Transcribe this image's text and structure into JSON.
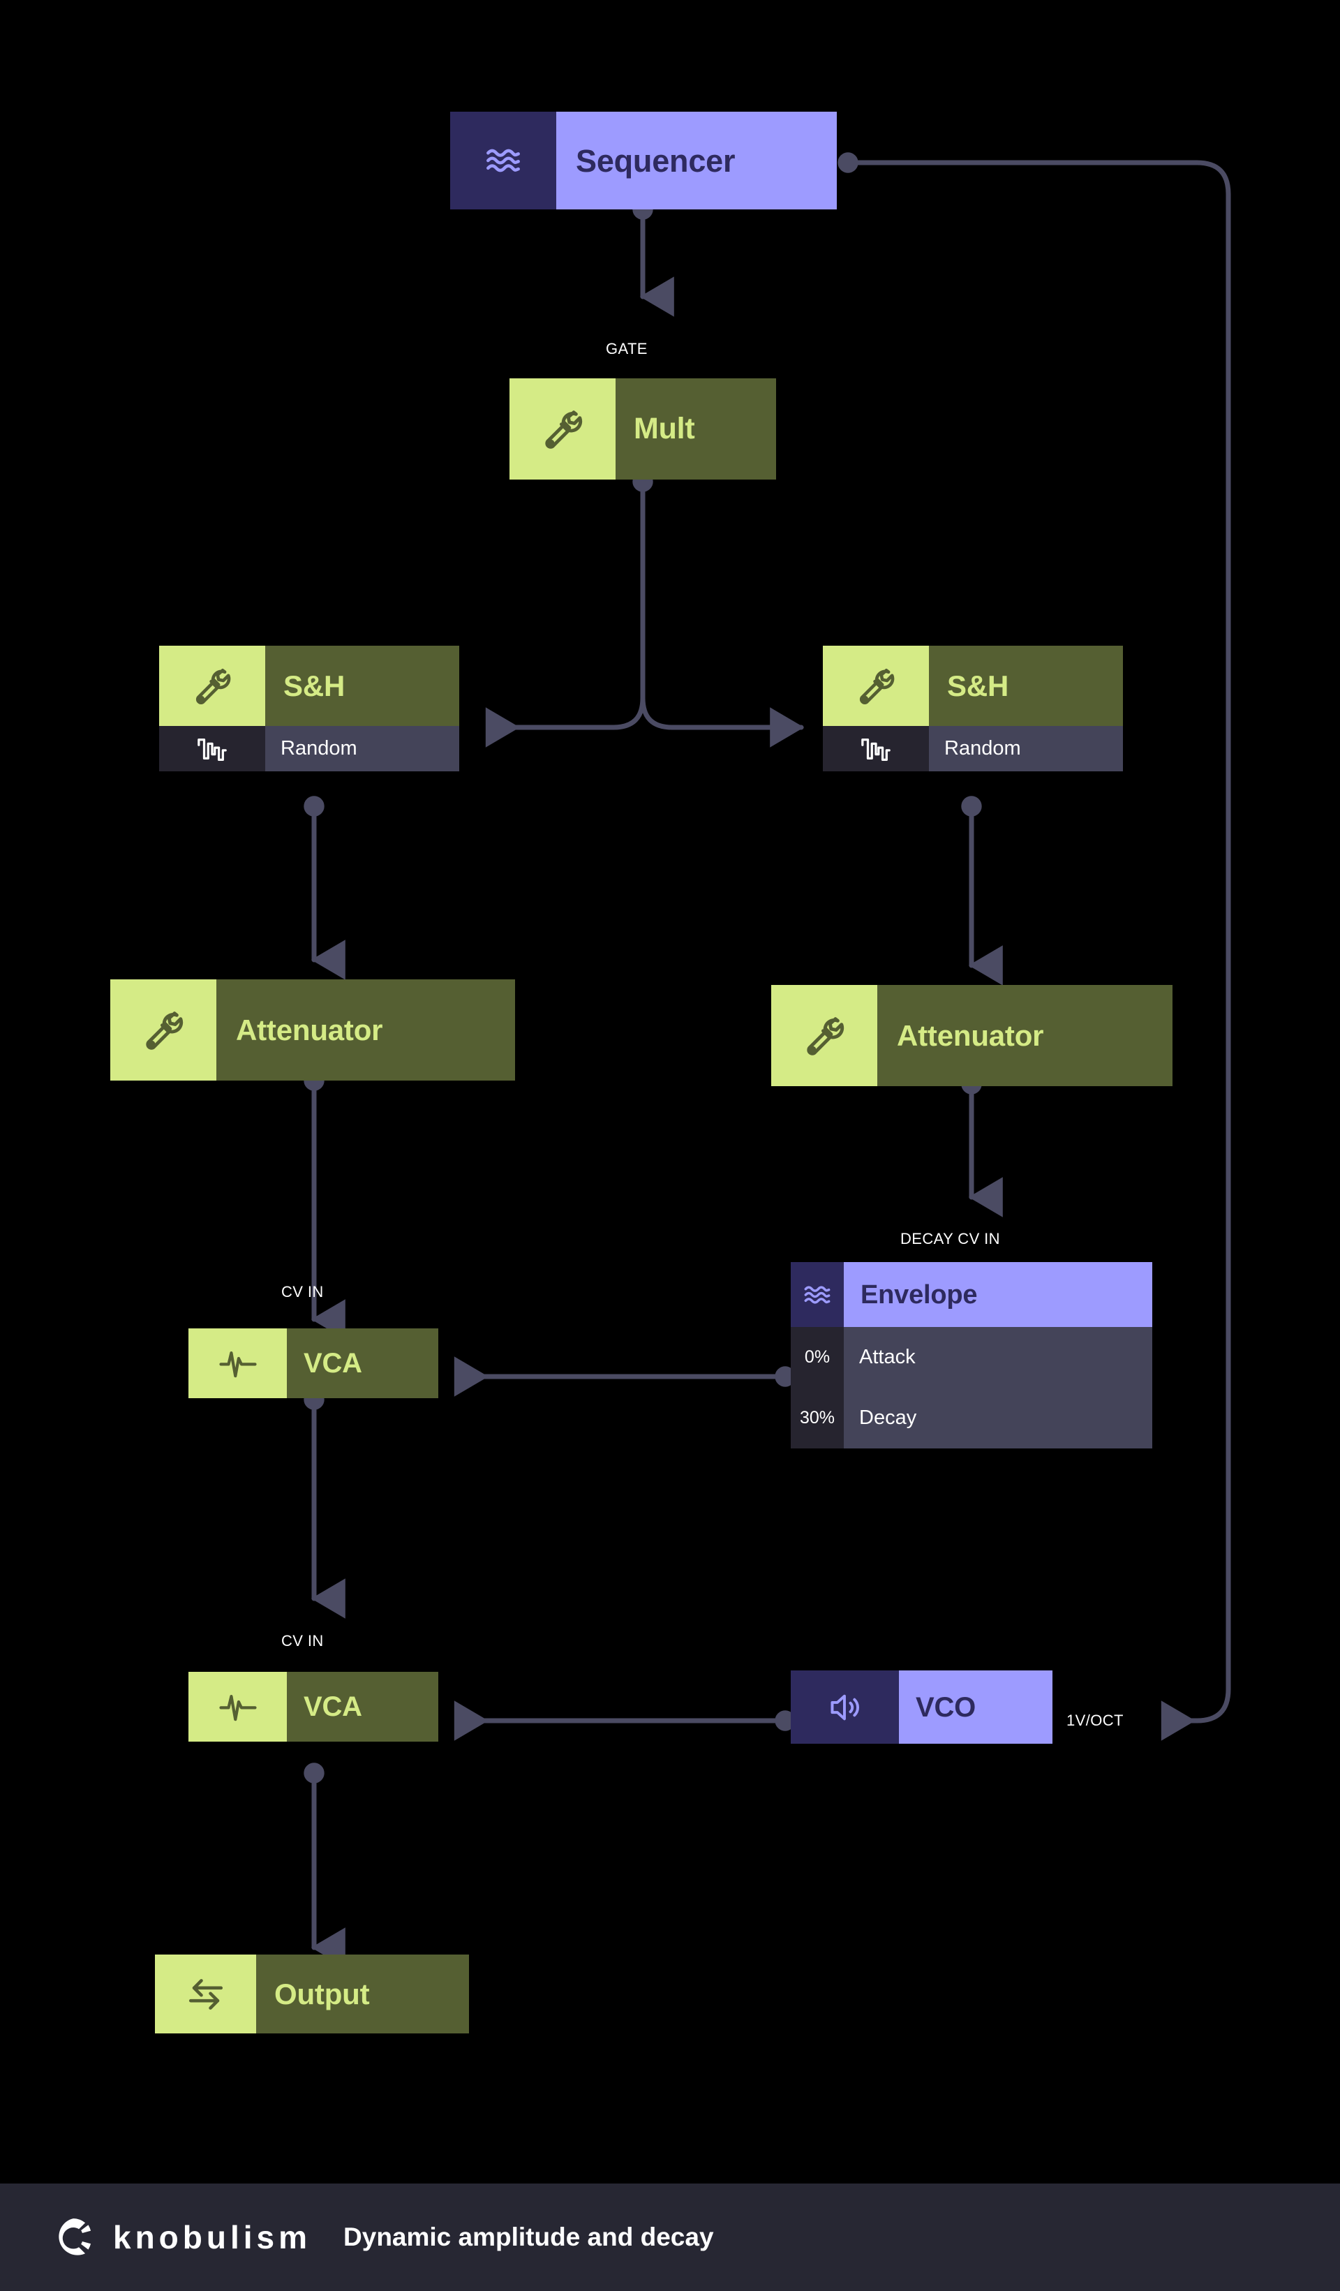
{
  "theme": {
    "background": "#000000",
    "green_icon_bg": "#d5eb86",
    "green_title_bg": "#555f32",
    "green_text": "#d5eb86",
    "purple_icon_bg": "#2e2a5e",
    "purple_title_bg": "#9d9bff",
    "purple_text": "#2e2a5e",
    "sub_key_bg": "#26242f",
    "sub_val_bg": "#444459",
    "wire_color": "#4b4b63",
    "footer_bg": "#272733",
    "label_text": "#ffffff"
  },
  "modules": {
    "sequencer": {
      "title": "Sequencer",
      "icon": "waves-icon"
    },
    "mult": {
      "title": "Mult",
      "icon": "wrench-icon"
    },
    "sh_left": {
      "title": "S&H",
      "icon": "wrench-icon",
      "sub": {
        "value": "",
        "label": "Random",
        "icon": "random-waveform-icon"
      }
    },
    "sh_right": {
      "title": "S&H",
      "icon": "wrench-icon",
      "sub": {
        "value": "",
        "label": "Random",
        "icon": "random-waveform-icon"
      }
    },
    "atten_left": {
      "title": "Attenuator",
      "icon": "wrench-icon"
    },
    "atten_right": {
      "title": "Attenuator",
      "icon": "wrench-icon"
    },
    "vca_upper": {
      "title": "VCA",
      "icon": "pulse-icon"
    },
    "vca_lower": {
      "title": "VCA",
      "icon": "pulse-icon"
    },
    "envelope": {
      "title": "Envelope",
      "icon": "waves-icon",
      "params": [
        {
          "value": "0%",
          "label": "Attack"
        },
        {
          "value": "30%",
          "label": "Decay"
        }
      ]
    },
    "vco": {
      "title": "VCO",
      "icon": "speaker-icon"
    },
    "output": {
      "title": "Output",
      "icon": "transfer-arrows-icon"
    }
  },
  "connections": [
    {
      "id": "gate",
      "label": "GATE"
    },
    {
      "id": "cv_in_upper",
      "label": "CV IN"
    },
    {
      "id": "cv_in_lower",
      "label": "CV IN"
    },
    {
      "id": "decay_cv_in",
      "label": "DECAY CV IN"
    },
    {
      "id": "one_v_oct",
      "label": "1V/OCT"
    }
  ],
  "footer": {
    "brand": "knobulism",
    "caption": "Dynamic amplitude and decay",
    "logo_icon": "knob-logo-icon"
  }
}
